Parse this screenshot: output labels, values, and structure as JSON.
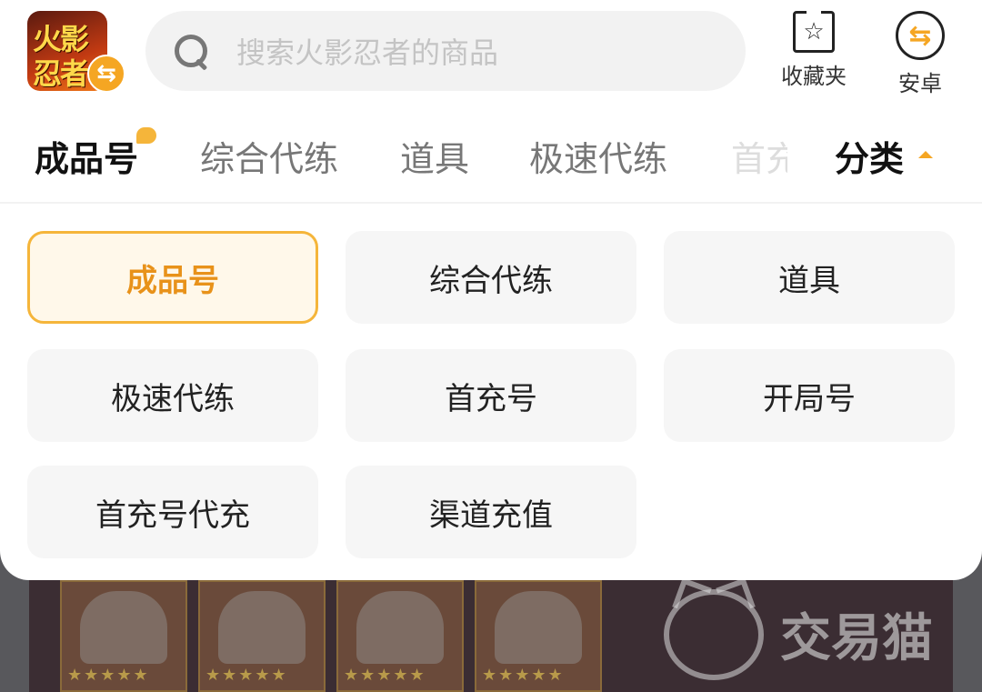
{
  "app": {
    "logo_line1": "火影",
    "logo_line2": "忍者",
    "logo_badge": "⇆"
  },
  "search": {
    "placeholder": "搜索火影忍者的商品"
  },
  "actions": {
    "favorites_label": "收藏夹",
    "favorites_icon": "star-folder-icon",
    "platform_label": "安卓",
    "platform_icon": "switch-arrows-icon"
  },
  "tabs": [
    {
      "label": "成品号",
      "active": true
    },
    {
      "label": "综合代练",
      "active": false
    },
    {
      "label": "道具",
      "active": false
    },
    {
      "label": "极速代练",
      "active": false
    },
    {
      "label": "首充",
      "active": false
    }
  ],
  "category_tab": {
    "label": "分类"
  },
  "category_grid": [
    {
      "label": "成品号",
      "selected": true
    },
    {
      "label": "综合代练",
      "selected": false
    },
    {
      "label": "道具",
      "selected": false
    },
    {
      "label": "极速代练",
      "selected": false
    },
    {
      "label": "首充号",
      "selected": false
    },
    {
      "label": "开局号",
      "selected": false
    },
    {
      "label": "首充号代充",
      "selected": false
    },
    {
      "label": "渠道充值",
      "selected": false
    }
  ],
  "background": {
    "watermark_text": "交易猫",
    "stars": "★★★★★"
  },
  "colors": {
    "accent": "#f5a623",
    "selected_text": "#e8921a",
    "selected_bg": "#fff8ea"
  }
}
